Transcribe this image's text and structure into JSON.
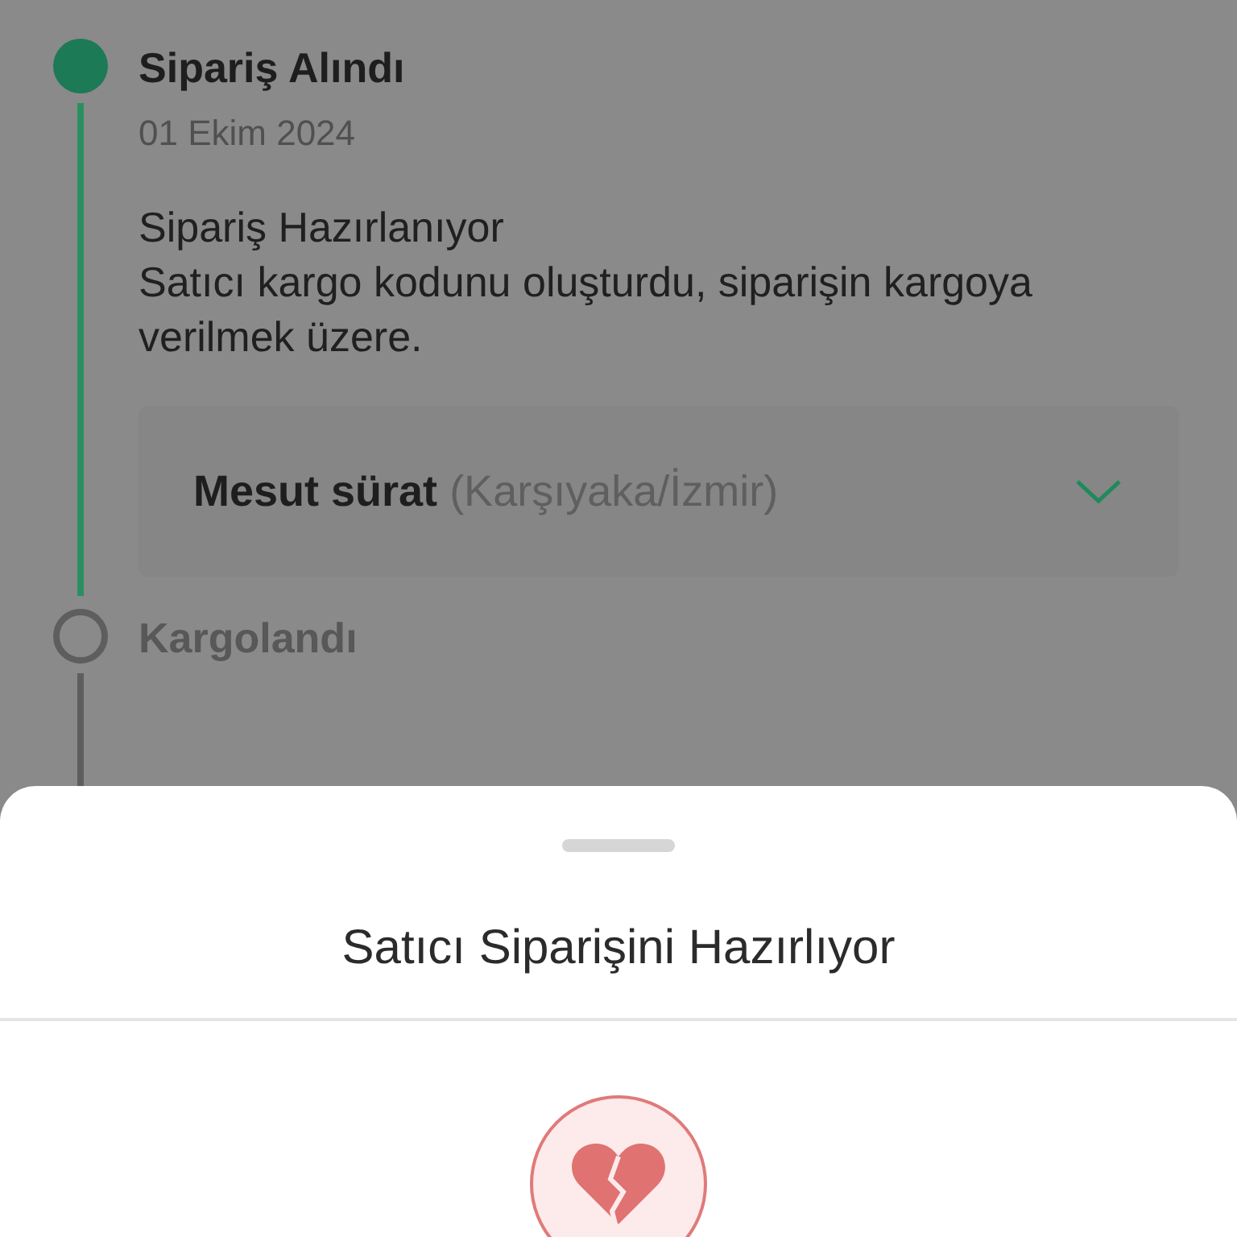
{
  "timeline": [
    {
      "title": "Sipariş Alındı",
      "done": true,
      "date": "01 Ekim 2024",
      "status": "Sipariş Hazırlanıyor",
      "note": "Satıcı kargo kodunu oluşturdu, siparişin kargoya verilmek üzere.",
      "seller": {
        "name": "Mesut sürat",
        "location": "(Karşıyaka/İzmir)",
        "expanded": false
      }
    },
    {
      "title": "Kargolandı",
      "done": false
    }
  ],
  "sheet": {
    "title": "Satıcı Siparişini Hazırlıyor"
  }
}
